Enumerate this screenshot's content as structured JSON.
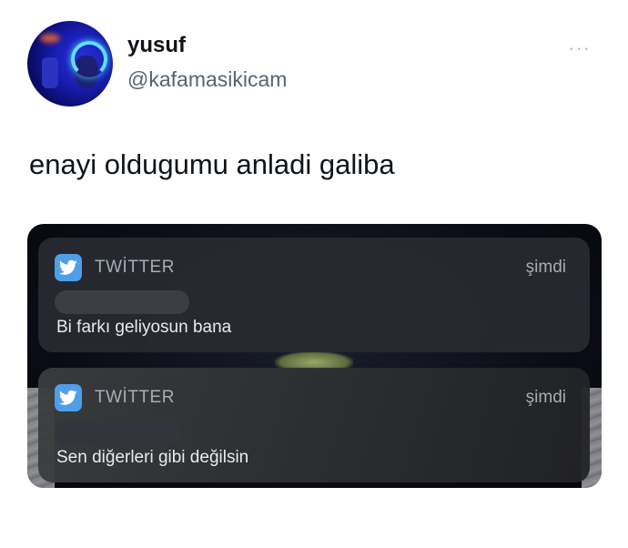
{
  "user": {
    "name": "yusuf",
    "handle": "@kafamasikicam"
  },
  "more_label": "···",
  "tweet": {
    "text": "enayi oldugumu anladi galiba"
  },
  "notifications": [
    {
      "app": "TWİTTER",
      "time": "şimdi",
      "message": "Bi farkı geliyosun bana"
    },
    {
      "app": "TWİTTER",
      "time": "şimdi",
      "message": "Sen diğerleri gibi değilsin"
    }
  ],
  "colors": {
    "twitter_blue": "#4f9fe8",
    "name_color": "#0f1419",
    "handle_color": "#536471"
  },
  "icons": {
    "app_icon": "twitter-bird-icon",
    "more": "more-dots-icon"
  }
}
